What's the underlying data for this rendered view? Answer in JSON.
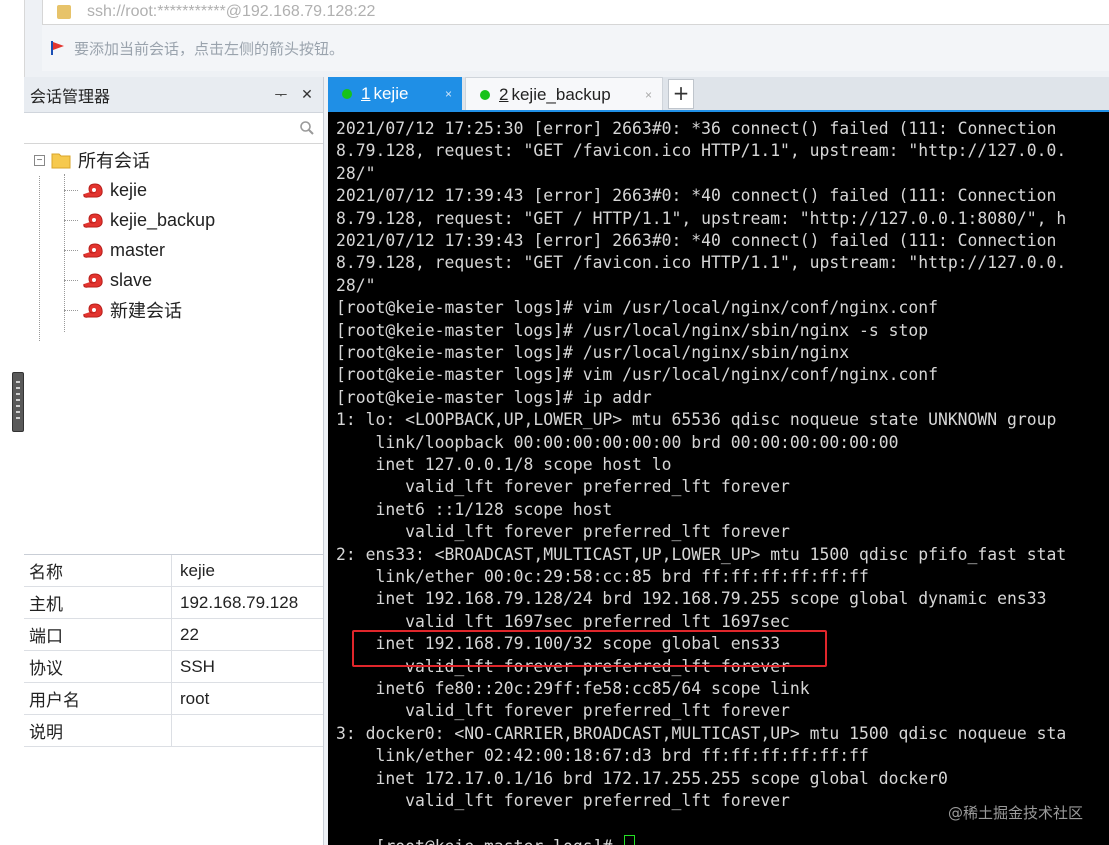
{
  "address_bar": {
    "text": "ssh://root:***********@192.168.79.128:22"
  },
  "hint_bar": {
    "text": "要添加当前会话，点击左侧的箭头按钮。"
  },
  "session_manager": {
    "title": "会话管理器",
    "pin_glyph": "ᅮ",
    "close_glyph": "✕",
    "search_placeholder": "",
    "tree": {
      "root_label": "所有会话",
      "expander_glyph": "−",
      "sessions": [
        "kejie",
        "kejie_backup",
        "master",
        "slave",
        "新建会话"
      ]
    },
    "properties": [
      {
        "key": "名称",
        "value": "kejie"
      },
      {
        "key": "主机",
        "value": "192.168.79.128"
      },
      {
        "key": "端口",
        "value": "22"
      },
      {
        "key": "协议",
        "value": "SSH"
      },
      {
        "key": "用户名",
        "value": "root"
      },
      {
        "key": "说明",
        "value": ""
      }
    ]
  },
  "tabs": [
    {
      "num": "1",
      "label": "kejie",
      "active": true,
      "close": "×"
    },
    {
      "num": "2",
      "label": "kejie_backup",
      "active": false,
      "close": "×"
    }
  ],
  "add_tab_glyph": "+",
  "terminal": {
    "lines": [
      "2021/07/12 17:25:30 [error] 2663#0: *36 connect() failed (111: Connection",
      "8.79.128, request: \"GET /favicon.ico HTTP/1.1\", upstream: \"http://127.0.0.",
      "28/\"",
      "2021/07/12 17:39:43 [error] 2663#0: *40 connect() failed (111: Connection",
      "8.79.128, request: \"GET / HTTP/1.1\", upstream: \"http://127.0.0.1:8080/\", h",
      "2021/07/12 17:39:43 [error] 2663#0: *40 connect() failed (111: Connection",
      "8.79.128, request: \"GET /favicon.ico HTTP/1.1\", upstream: \"http://127.0.0.",
      "28/\"",
      "[root@keie-master logs]# vim /usr/local/nginx/conf/nginx.conf",
      "[root@keie-master logs]# /usr/local/nginx/sbin/nginx -s stop",
      "[root@keie-master logs]# /usr/local/nginx/sbin/nginx",
      "[root@keie-master logs]# vim /usr/local/nginx/conf/nginx.conf",
      "[root@keie-master logs]# ip addr",
      "1: lo: <LOOPBACK,UP,LOWER_UP> mtu 65536 qdisc noqueue state UNKNOWN group",
      "    link/loopback 00:00:00:00:00:00 brd 00:00:00:00:00:00",
      "    inet 127.0.0.1/8 scope host lo",
      "       valid_lft forever preferred_lft forever",
      "    inet6 ::1/128 scope host",
      "       valid_lft forever preferred_lft forever",
      "2: ens33: <BROADCAST,MULTICAST,UP,LOWER_UP> mtu 1500 qdisc pfifo_fast stat",
      "    link/ether 00:0c:29:58:cc:85 brd ff:ff:ff:ff:ff:ff",
      "    inet 192.168.79.128/24 brd 192.168.79.255 scope global dynamic ens33",
      "       valid_lft 1697sec preferred_lft 1697sec",
      "    inet 192.168.79.100/32 scope global ens33",
      "       valid_lft forever preferred_lft forever",
      "    inet6 fe80::20c:29ff:fe58:cc85/64 scope link",
      "       valid_lft forever preferred_lft forever",
      "3: docker0: <NO-CARRIER,BROADCAST,MULTICAST,UP> mtu 1500 qdisc noqueue sta",
      "    link/ether 02:42:00:18:67:d3 brd ff:ff:ff:ff:ff:ff",
      "    inet 172.17.0.1/16 brd 172.17.255.255 scope global docker0",
      "       valid_lft forever preferred_lft forever"
    ],
    "prompt": "[root@keie-master logs]# ",
    "highlighted_line_index": 23
  },
  "watermark": "@稀土掘金技术社区",
  "colors": {
    "accent": "#1f8fe6",
    "terminal_bg": "#000000",
    "terminal_fg": "#d6d6d6",
    "highlight": "#e0262b",
    "connected": "#17c21a"
  }
}
